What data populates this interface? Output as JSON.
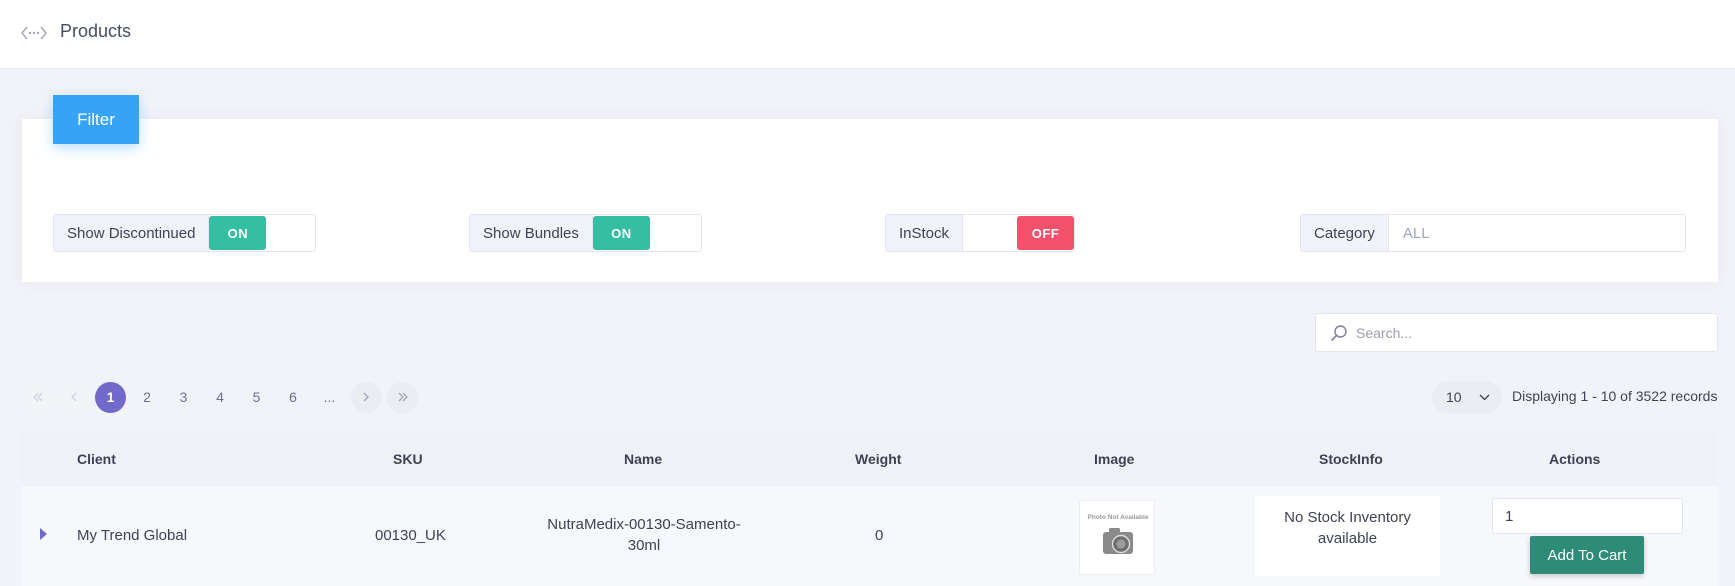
{
  "header": {
    "title": "Products",
    "back_icon": "back-arrow-icon"
  },
  "filter": {
    "tab_label": "Filter",
    "show_discontinued": {
      "label": "Show Discontinued",
      "state": "ON"
    },
    "show_bundles": {
      "label": "Show Bundles",
      "state": "ON"
    },
    "in_stock": {
      "label": "InStock",
      "state": "OFF"
    },
    "category": {
      "label": "Category",
      "value": "ALL"
    }
  },
  "search": {
    "placeholder": "Search...",
    "icon": "search-icon"
  },
  "pagination": {
    "pages": [
      "1",
      "2",
      "3",
      "4",
      "5",
      "6",
      "..."
    ],
    "current_page": "1",
    "page_size": "10",
    "records_text": "Displaying 1 - 10 of 3522 records"
  },
  "table": {
    "columns": {
      "client": "Client",
      "sku": "SKU",
      "name": "Name",
      "weight": "Weight",
      "image": "Image",
      "stockinfo": "StockInfo",
      "actions": "Actions"
    },
    "rows": [
      {
        "client": "My Trend Global",
        "sku": "00130_UK",
        "name_line1": "NutraMedix-00130-Samento-",
        "name_line2": "30ml",
        "weight": "0",
        "image_text": "Photo Not Available",
        "stock_line1": "No Stock Inventory",
        "stock_line2": "available",
        "qty": "1",
        "add_to_cart": "Add To Cart"
      }
    ]
  },
  "colors": {
    "filter_tab": "#36a3f7",
    "toggle_on": "#34bfa3",
    "toggle_off": "#f4516c",
    "active_page": "#716aca",
    "add_to_cart": "#2e8b77"
  }
}
